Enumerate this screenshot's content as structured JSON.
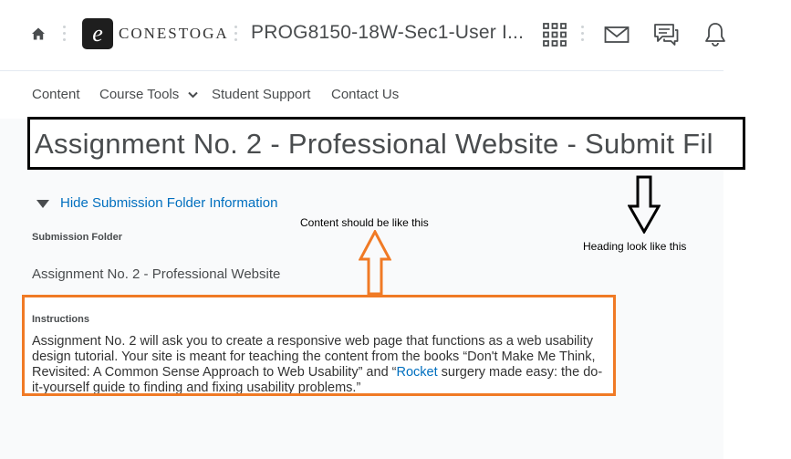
{
  "header": {
    "logo_letter": "e",
    "logo_text": "CONESTOGA",
    "course_title": "PROG8150-18W-Sec1-User I..."
  },
  "nav": {
    "items": [
      {
        "label": "Content"
      },
      {
        "label": "Course Tools"
      },
      {
        "label": "Student Support"
      },
      {
        "label": "Contact Us"
      }
    ]
  },
  "page": {
    "heading": "Assignment No. 2 - Professional Website - Submit Fil",
    "toggle_label": "Hide Submission Folder Information",
    "submission_folder_label": "Submission Folder",
    "submission_folder_name": "Assignment No. 2 - Professional Website",
    "instructions_label": "Instructions",
    "instructions_text_1": "Assignment No. 2 will ask you to create a responsive web page that functions as a web usability design tutorial. Your site is meant for teaching the content from the books “Don't Make Me Think, Revisited: A Common Sense Approach to Web Usability” and “",
    "instructions_link": "Rocket",
    "instructions_text_2": " surgery made easy: the do-it-yourself guide to finding and fixing usability problems.”"
  },
  "annotations": {
    "content_note": "Content should be like this",
    "heading_note": "Heading look like this",
    "content_color": "#f07a25",
    "heading_color": "#000000"
  },
  "icons": [
    "home-icon",
    "apps-grid-icon",
    "mail-icon",
    "chat-icon",
    "bell-icon",
    "chevron-down-icon",
    "triangle-down-icon",
    "arrow-up-icon",
    "arrow-down-icon"
  ]
}
